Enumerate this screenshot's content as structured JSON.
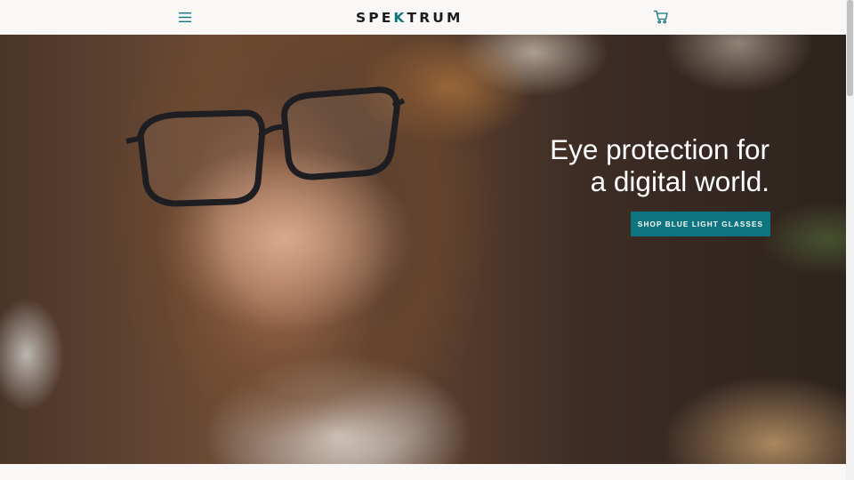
{
  "header": {
    "logo": {
      "prefix": "SPE",
      "accent": "K",
      "suffix": "TRUM"
    },
    "menu_icon": "hamburger-menu-icon",
    "cart_icon": "shopping-cart-icon"
  },
  "hero": {
    "title_line1": "Eye protection for",
    "title_line2": "a digital world.",
    "cta_label": "SHOP BLUE LIGHT GLASSES"
  },
  "colors": {
    "accent": "#0e7580",
    "logo_text": "#1c1c1c",
    "header_background": "#f9f8f6",
    "cta_text": "#ffffff"
  }
}
